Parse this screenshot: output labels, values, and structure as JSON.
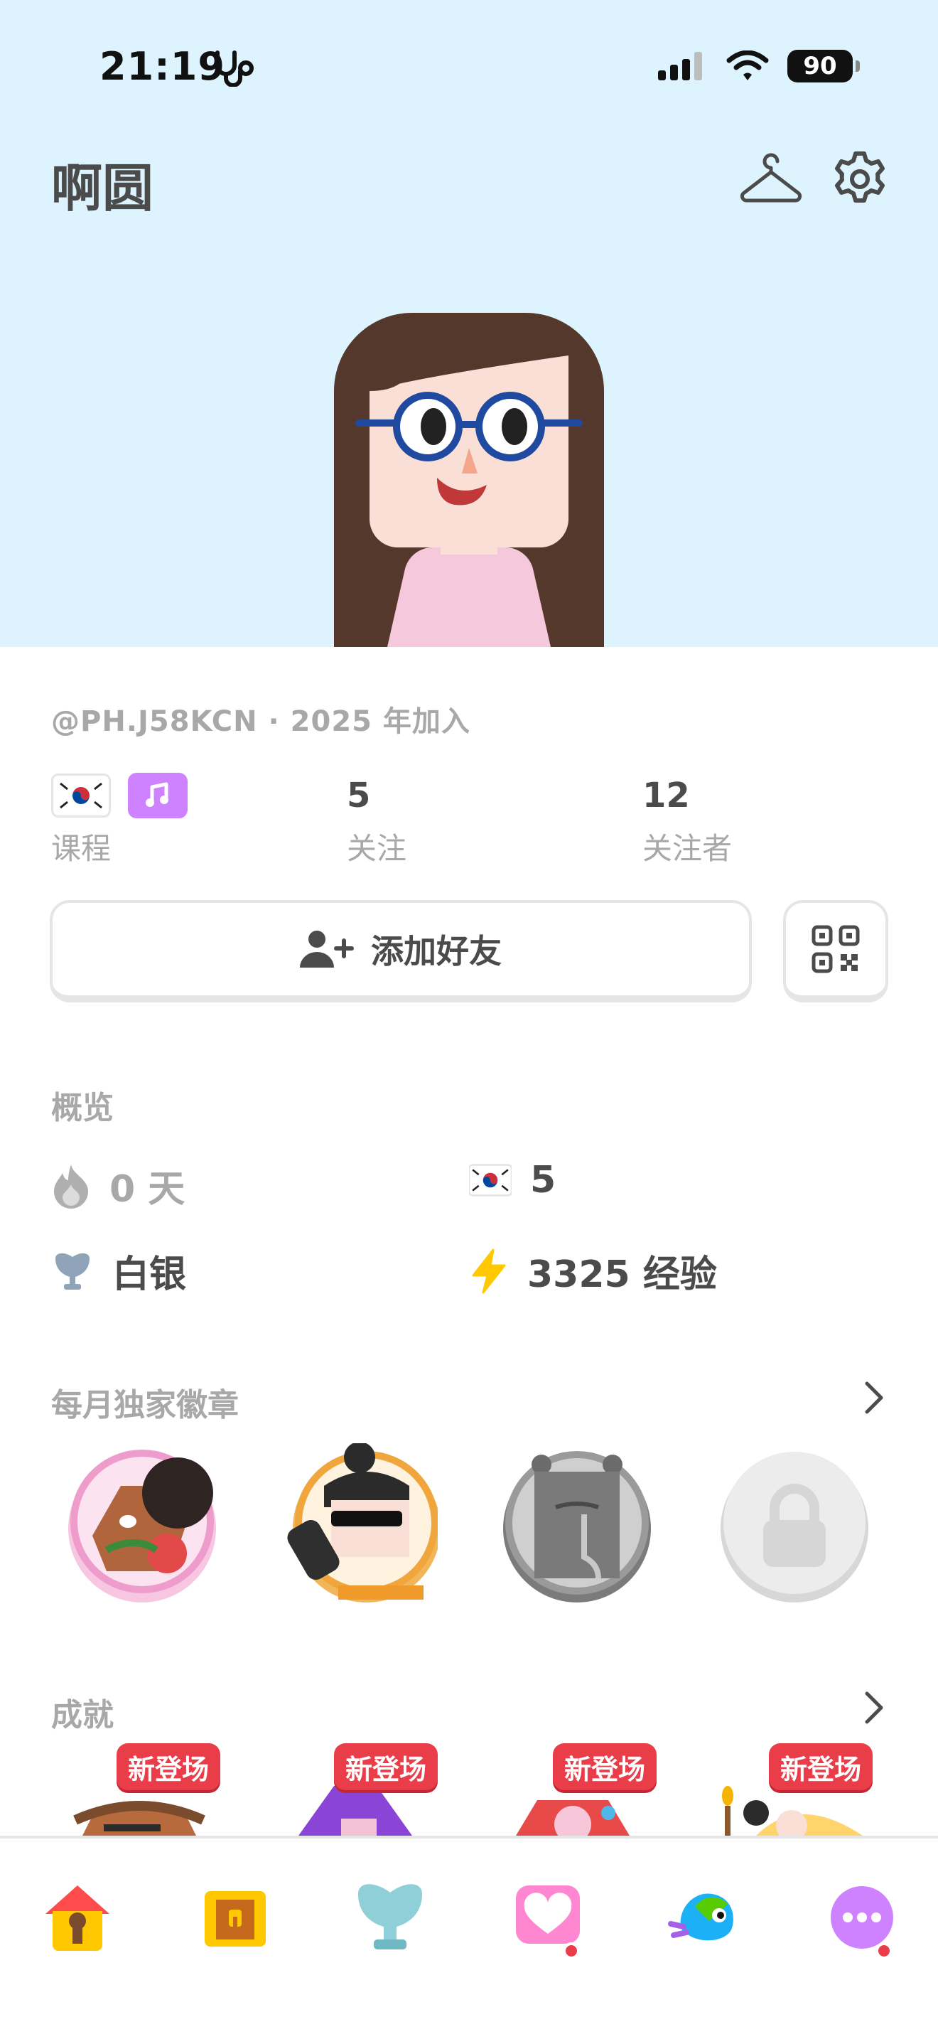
{
  "status_bar": {
    "time": "21:19",
    "battery": "90"
  },
  "profile": {
    "name": "啊圆",
    "handle": "@PH.J58KCN",
    "separator": "·",
    "joined": "2025 年加入"
  },
  "stats": {
    "courses_label": "课程",
    "following_count": "5",
    "following_label": "关注",
    "followers_count": "12",
    "followers_label": "关注者"
  },
  "actions": {
    "add_friend_label": "添加好友"
  },
  "overview": {
    "title": "概览",
    "streak": "0 天",
    "course_level": "5",
    "league": "白银",
    "xp": "3325 经验"
  },
  "monthly_badges": {
    "title": "每月独家徽章"
  },
  "achievements": {
    "title": "成就",
    "items": [
      {
        "tag": "新登场"
      },
      {
        "tag": "新登场"
      },
      {
        "tag": "新登场"
      },
      {
        "tag": "新登场"
      }
    ]
  },
  "colors": {
    "hero_bg": "#ddf4ff",
    "accent_purple": "#ce82ff",
    "new_tag": "#ea3d4a",
    "xp_yellow": "#ffc800",
    "muted_text": "#a8a8a8"
  },
  "icons": {
    "header": [
      "hanger-icon",
      "gear-icon"
    ],
    "overview": [
      "flame-icon",
      "korea-flag-icon",
      "league-trophy-icon",
      "lightning-icon"
    ],
    "tabs": [
      "home-icon",
      "chest-icon",
      "league-icon",
      "heart-icon",
      "duo-icon",
      "more-icon"
    ]
  }
}
